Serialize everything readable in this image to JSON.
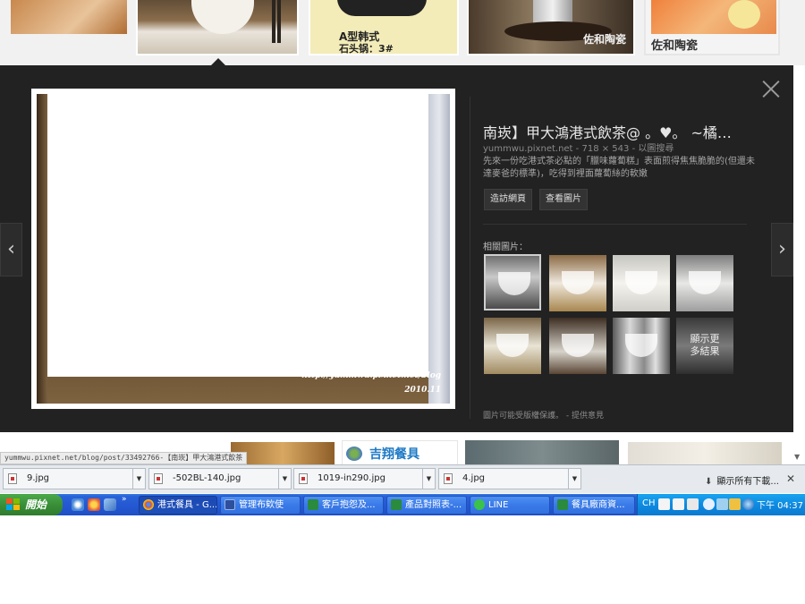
{
  "top_thumbnails": {
    "thumb3_line1": "A型韩式",
    "thumb3_line2": "石头锅：3#",
    "thumb4_watermark": "佐和陶瓷",
    "thumb5_caption": "佐和陶瓷"
  },
  "preview": {
    "close_symbol": "✕",
    "prev_symbol": "‹",
    "next_symbol": "›",
    "watermark_url": "http://yummwu.pixnet.net/blog",
    "watermark_date": "2010.11",
    "title": "南崁】甲大鴻港式飲茶@ 。♥。 ~橘…",
    "meta_source": "yummwu.pixnet.net",
    "meta_size": "718 × 543",
    "meta_search": "以圖搜尋",
    "description": "先來一份吃港式茶必點的「臘味蘿蔔糕」表面煎得焦焦脆脆的(但還未達麥爸的標準)，吃得到裡面蘿蔔絲的軟嫩",
    "visit_button": "造訪網頁",
    "view_button": "查看圖片",
    "related_label": "相關圖片：",
    "more_results_line1": "顯示更",
    "more_results_line2": "多結果",
    "rights_text": "圖片可能受版權保護。",
    "feedback_link": "提供意見"
  },
  "bottom_thumbnails": {
    "thumb2_text": "吉翔餐具"
  },
  "status_url": "yummwu.pixnet.net/blog/post/33492766-【南崁】甲大鴻港式飲茶",
  "downloads": {
    "items": [
      {
        "name": "9.jpg"
      },
      {
        "name": "-502BL-140.jpg"
      },
      {
        "name": "1019-in290.jpg"
      },
      {
        "name": "4.jpg"
      }
    ],
    "show_all": "顯示所有下載...",
    "close_symbol": "✕"
  },
  "taskbar": {
    "start_label": "開始",
    "tasks": [
      {
        "label": "港式餐具 - G..."
      },
      {
        "label": "管理布欸使"
      },
      {
        "label": "客戶抱怨及..."
      },
      {
        "label": "產品對照表-..."
      },
      {
        "label": "LINE"
      },
      {
        "label": "餐具廠商資..."
      }
    ],
    "language": "CH",
    "time": "下午 04:37"
  },
  "colors": {
    "panel_bg": "#222222",
    "taskbar_blue": "#2458d2",
    "start_green": "#3a8f38",
    "tray_blue": "#0e8ae0"
  }
}
